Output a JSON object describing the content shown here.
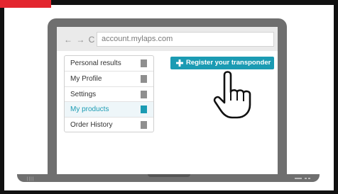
{
  "browser": {
    "nav_glyphs": "← → C",
    "address": "account.mylaps.com"
  },
  "menu": {
    "items": [
      {
        "label": "Personal results",
        "active": false
      },
      {
        "label": "My Profile",
        "active": false
      },
      {
        "label": "Settings",
        "active": false
      },
      {
        "label": "My products",
        "active": true
      },
      {
        "label": "Order History",
        "active": false
      }
    ]
  },
  "action": {
    "register_label": "Register your transponder",
    "icon": "plus-icon"
  },
  "pointer": {
    "icon": "hand-pointer-icon"
  },
  "colors": {
    "accent": "#1b9bb3",
    "brand_red": "#e3262f",
    "laptop": "#6f6f6f",
    "frame": "#111111"
  }
}
